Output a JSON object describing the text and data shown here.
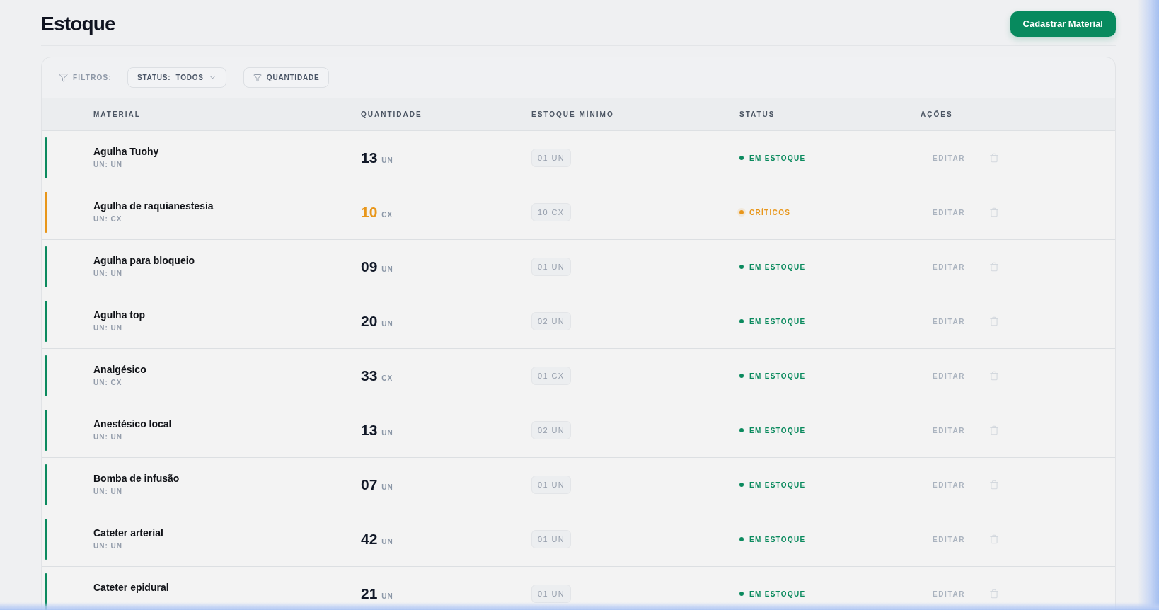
{
  "page": {
    "title": "Estoque"
  },
  "primary_action": {
    "label": "Cadastrar Material"
  },
  "filters": {
    "label": "FILTROS:",
    "status_filter": {
      "label": "STATUS:",
      "value": "TODOS"
    },
    "quantity_filter": {
      "label": "QUANTIDADE"
    }
  },
  "table": {
    "columns": [
      "MATERIAL",
      "QUANTIDADE",
      "ESTOQUE MÍNIMO",
      "STATUS",
      "AÇÕES"
    ],
    "rows": [
      {
        "name": "Agulha Tuohy",
        "unit_label": "UN: UN",
        "quantity": "13",
        "unit": "UN",
        "minimum": "01 UN",
        "status": {
          "label": "EM ESTOQUE",
          "kind": "in_stock"
        },
        "action": "EDITAR"
      },
      {
        "name": "Agulha de raquianestesia",
        "unit_label": "UN: CX",
        "quantity": "10",
        "unit": "CX",
        "minimum": "10 CX",
        "status": {
          "label": "CRÍTICOS",
          "kind": "critical"
        },
        "action": "EDITAR"
      },
      {
        "name": "Agulha para bloqueio",
        "unit_label": "UN: UN",
        "quantity": "09",
        "unit": "UN",
        "minimum": "01 UN",
        "status": {
          "label": "EM ESTOQUE",
          "kind": "in_stock"
        },
        "action": "EDITAR"
      },
      {
        "name": "Agulha top",
        "unit_label": "UN: UN",
        "quantity": "20",
        "unit": "UN",
        "minimum": "02 UN",
        "status": {
          "label": "EM ESTOQUE",
          "kind": "in_stock"
        },
        "action": "EDITAR"
      },
      {
        "name": "Analgésico",
        "unit_label": "UN: CX",
        "quantity": "33",
        "unit": "CX",
        "minimum": "01 CX",
        "status": {
          "label": "EM ESTOQUE",
          "kind": "in_stock"
        },
        "action": "EDITAR"
      },
      {
        "name": "Anestésico local",
        "unit_label": "UN: UN",
        "quantity": "13",
        "unit": "UN",
        "minimum": "02 UN",
        "status": {
          "label": "EM ESTOQUE",
          "kind": "in_stock"
        },
        "action": "EDITAR"
      },
      {
        "name": "Bomba de infusão",
        "unit_label": "UN: UN",
        "quantity": "07",
        "unit": "UN",
        "minimum": "01 UN",
        "status": {
          "label": "EM ESTOQUE",
          "kind": "in_stock"
        },
        "action": "EDITAR"
      },
      {
        "name": "Cateter arterial",
        "unit_label": "UN: UN",
        "quantity": "42",
        "unit": "UN",
        "minimum": "01 UN",
        "status": {
          "label": "EM ESTOQUE",
          "kind": "in_stock"
        },
        "action": "EDITAR"
      },
      {
        "name": "Cateter epidural",
        "quantity": "21",
        "unit": "UN",
        "minimum": "01 UN",
        "status": {
          "label": "EM ESTOQUE",
          "kind": "in_stock"
        },
        "action": "EDITAR"
      }
    ]
  }
}
